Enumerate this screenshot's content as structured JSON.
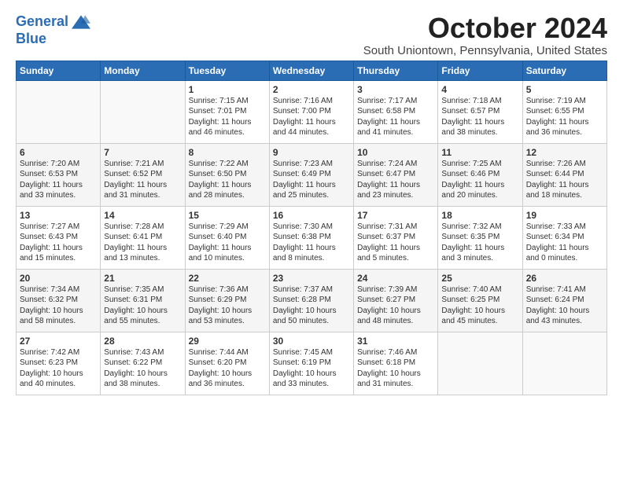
{
  "logo": {
    "line1": "General",
    "line2": "Blue"
  },
  "title": "October 2024",
  "location": "South Uniontown, Pennsylvania, United States",
  "days_header": [
    "Sunday",
    "Monday",
    "Tuesday",
    "Wednesday",
    "Thursday",
    "Friday",
    "Saturday"
  ],
  "weeks": [
    [
      {
        "num": "",
        "detail": ""
      },
      {
        "num": "",
        "detail": ""
      },
      {
        "num": "1",
        "detail": "Sunrise: 7:15 AM\nSunset: 7:01 PM\nDaylight: 11 hours\nand 46 minutes."
      },
      {
        "num": "2",
        "detail": "Sunrise: 7:16 AM\nSunset: 7:00 PM\nDaylight: 11 hours\nand 44 minutes."
      },
      {
        "num": "3",
        "detail": "Sunrise: 7:17 AM\nSunset: 6:58 PM\nDaylight: 11 hours\nand 41 minutes."
      },
      {
        "num": "4",
        "detail": "Sunrise: 7:18 AM\nSunset: 6:57 PM\nDaylight: 11 hours\nand 38 minutes."
      },
      {
        "num": "5",
        "detail": "Sunrise: 7:19 AM\nSunset: 6:55 PM\nDaylight: 11 hours\nand 36 minutes."
      }
    ],
    [
      {
        "num": "6",
        "detail": "Sunrise: 7:20 AM\nSunset: 6:53 PM\nDaylight: 11 hours\nand 33 minutes."
      },
      {
        "num": "7",
        "detail": "Sunrise: 7:21 AM\nSunset: 6:52 PM\nDaylight: 11 hours\nand 31 minutes."
      },
      {
        "num": "8",
        "detail": "Sunrise: 7:22 AM\nSunset: 6:50 PM\nDaylight: 11 hours\nand 28 minutes."
      },
      {
        "num": "9",
        "detail": "Sunrise: 7:23 AM\nSunset: 6:49 PM\nDaylight: 11 hours\nand 25 minutes."
      },
      {
        "num": "10",
        "detail": "Sunrise: 7:24 AM\nSunset: 6:47 PM\nDaylight: 11 hours\nand 23 minutes."
      },
      {
        "num": "11",
        "detail": "Sunrise: 7:25 AM\nSunset: 6:46 PM\nDaylight: 11 hours\nand 20 minutes."
      },
      {
        "num": "12",
        "detail": "Sunrise: 7:26 AM\nSunset: 6:44 PM\nDaylight: 11 hours\nand 18 minutes."
      }
    ],
    [
      {
        "num": "13",
        "detail": "Sunrise: 7:27 AM\nSunset: 6:43 PM\nDaylight: 11 hours\nand 15 minutes."
      },
      {
        "num": "14",
        "detail": "Sunrise: 7:28 AM\nSunset: 6:41 PM\nDaylight: 11 hours\nand 13 minutes."
      },
      {
        "num": "15",
        "detail": "Sunrise: 7:29 AM\nSunset: 6:40 PM\nDaylight: 11 hours\nand 10 minutes."
      },
      {
        "num": "16",
        "detail": "Sunrise: 7:30 AM\nSunset: 6:38 PM\nDaylight: 11 hours\nand 8 minutes."
      },
      {
        "num": "17",
        "detail": "Sunrise: 7:31 AM\nSunset: 6:37 PM\nDaylight: 11 hours\nand 5 minutes."
      },
      {
        "num": "18",
        "detail": "Sunrise: 7:32 AM\nSunset: 6:35 PM\nDaylight: 11 hours\nand 3 minutes."
      },
      {
        "num": "19",
        "detail": "Sunrise: 7:33 AM\nSunset: 6:34 PM\nDaylight: 11 hours\nand 0 minutes."
      }
    ],
    [
      {
        "num": "20",
        "detail": "Sunrise: 7:34 AM\nSunset: 6:32 PM\nDaylight: 10 hours\nand 58 minutes."
      },
      {
        "num": "21",
        "detail": "Sunrise: 7:35 AM\nSunset: 6:31 PM\nDaylight: 10 hours\nand 55 minutes."
      },
      {
        "num": "22",
        "detail": "Sunrise: 7:36 AM\nSunset: 6:29 PM\nDaylight: 10 hours\nand 53 minutes."
      },
      {
        "num": "23",
        "detail": "Sunrise: 7:37 AM\nSunset: 6:28 PM\nDaylight: 10 hours\nand 50 minutes."
      },
      {
        "num": "24",
        "detail": "Sunrise: 7:39 AM\nSunset: 6:27 PM\nDaylight: 10 hours\nand 48 minutes."
      },
      {
        "num": "25",
        "detail": "Sunrise: 7:40 AM\nSunset: 6:25 PM\nDaylight: 10 hours\nand 45 minutes."
      },
      {
        "num": "26",
        "detail": "Sunrise: 7:41 AM\nSunset: 6:24 PM\nDaylight: 10 hours\nand 43 minutes."
      }
    ],
    [
      {
        "num": "27",
        "detail": "Sunrise: 7:42 AM\nSunset: 6:23 PM\nDaylight: 10 hours\nand 40 minutes."
      },
      {
        "num": "28",
        "detail": "Sunrise: 7:43 AM\nSunset: 6:22 PM\nDaylight: 10 hours\nand 38 minutes."
      },
      {
        "num": "29",
        "detail": "Sunrise: 7:44 AM\nSunset: 6:20 PM\nDaylight: 10 hours\nand 36 minutes."
      },
      {
        "num": "30",
        "detail": "Sunrise: 7:45 AM\nSunset: 6:19 PM\nDaylight: 10 hours\nand 33 minutes."
      },
      {
        "num": "31",
        "detail": "Sunrise: 7:46 AM\nSunset: 6:18 PM\nDaylight: 10 hours\nand 31 minutes."
      },
      {
        "num": "",
        "detail": ""
      },
      {
        "num": "",
        "detail": ""
      }
    ]
  ]
}
